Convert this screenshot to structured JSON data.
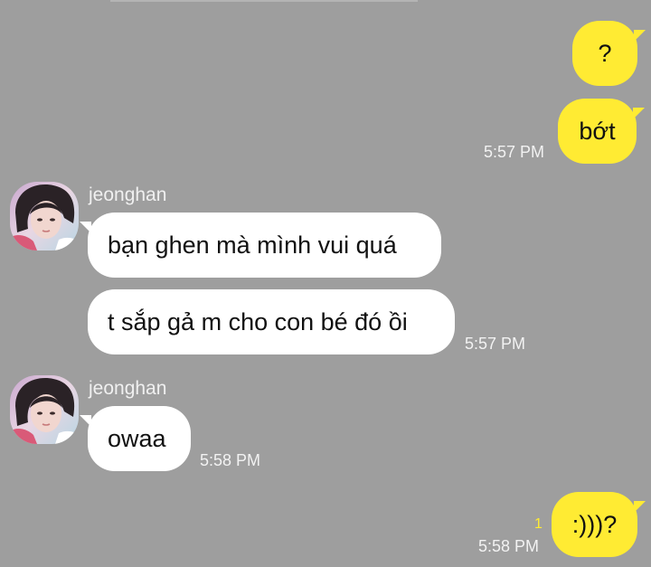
{
  "messages": [
    {
      "direction": "out",
      "text": "?"
    },
    {
      "direction": "out",
      "text": "bớt",
      "time": "5:57 PM"
    },
    {
      "direction": "in",
      "sender": "jeonghan",
      "text": "bạn ghen mà mình vui quá"
    },
    {
      "direction": "in",
      "text": "t sắp gả m cho con bé đó ồi",
      "time": "5:57 PM"
    },
    {
      "direction": "in",
      "sender": "jeonghan",
      "text": "owaa",
      "time": "5:58 PM"
    },
    {
      "direction": "out",
      "text": ":)))?",
      "time": "5:58 PM",
      "unread_count": "1"
    }
  ],
  "colors": {
    "background": "#9e9e9e",
    "outgoing_bubble": "#ffeb33",
    "incoming_bubble": "#ffffff",
    "unread_count": "#ffeb33"
  },
  "icons": {
    "avatar": "profile-photo-avatar"
  }
}
